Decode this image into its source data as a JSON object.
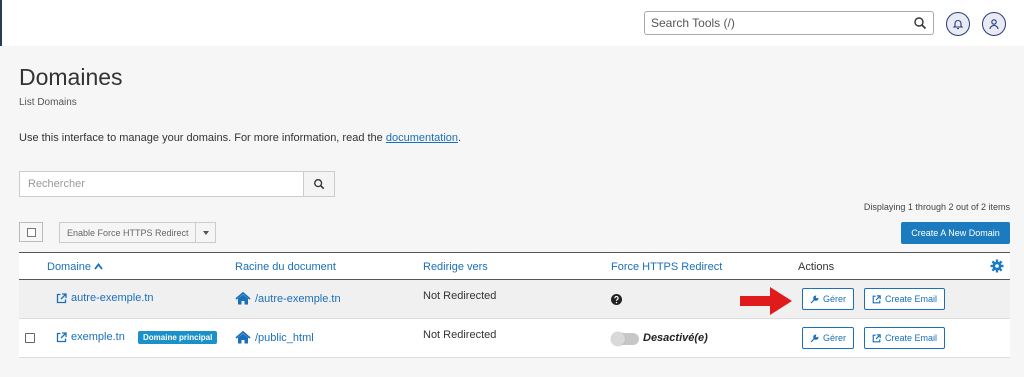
{
  "header": {
    "search_placeholder": "Search Tools (/)"
  },
  "page": {
    "title": "Domaines",
    "subtitle": "List Domains",
    "intro_text": "Use this interface to manage your domains. For more information, read the ",
    "intro_link": "documentation",
    "intro_end": "."
  },
  "filter": {
    "placeholder": "Rechercher"
  },
  "toolbar": {
    "displaying": "Displaying 1 through 2 out of 2 items",
    "https_button": "Enable Force HTTPS Redirect",
    "create_button": "Create A New Domain"
  },
  "table": {
    "columns": {
      "domain": "Domaine",
      "docroot": "Racine du document",
      "redirect": "Redirige vers",
      "https": "Force HTTPS Redirect",
      "actions": "Actions"
    },
    "rows": [
      {
        "domain": "autre-exemple.tn",
        "badge": "",
        "docroot": "/autre-exemple.tn",
        "redirect": "Not Redirected",
        "https_status": "",
        "manage": "Gérer",
        "email": "Create Email"
      },
      {
        "domain": "exemple.tn",
        "badge": "Domaine principal",
        "docroot": "/public_html",
        "redirect": "Not Redirected",
        "https_status": "Desactivé(e)",
        "manage": "Gérer",
        "email": "Create Email"
      }
    ]
  },
  "colors": {
    "accent": "#1c7bbf",
    "link": "#1a6fb8",
    "badge": "#1c90c9",
    "arrow": "#e01b1b"
  }
}
